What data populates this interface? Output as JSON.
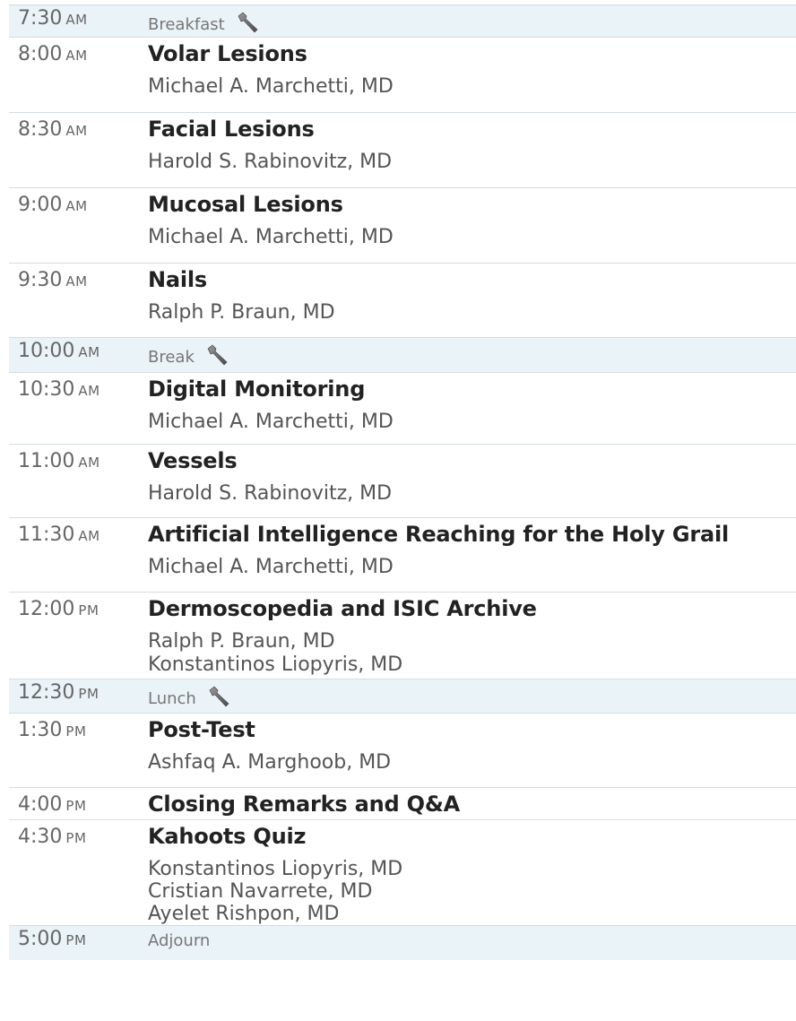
{
  "schedule": [
    {
      "time": "7:30",
      "meridiem": "AM",
      "type": "break",
      "label": "Breakfast",
      "icon": "wrench-icon"
    },
    {
      "time": "8:00",
      "meridiem": "AM",
      "type": "session",
      "title": "Volar Lesions",
      "speakers": [
        "Michael A. Marchetti, MD"
      ]
    },
    {
      "time": "8:30",
      "meridiem": "AM",
      "type": "session",
      "title": "Facial Lesions",
      "speakers": [
        "Harold S. Rabinovitz, MD"
      ]
    },
    {
      "time": "9:00",
      "meridiem": "AM",
      "type": "session",
      "title": "Mucosal Lesions",
      "speakers": [
        "Michael A. Marchetti, MD"
      ]
    },
    {
      "time": "9:30",
      "meridiem": "AM",
      "type": "session",
      "title": "Nails",
      "speakers": [
        "Ralph P. Braun, MD"
      ]
    },
    {
      "time": "10:00",
      "meridiem": "AM",
      "type": "break",
      "label": "Break",
      "icon": "wrench-icon"
    },
    {
      "time": "10:30",
      "meridiem": "AM",
      "type": "session",
      "title": "Digital Monitoring",
      "speakers": [
        "Michael A. Marchetti, MD"
      ]
    },
    {
      "time": "11:00",
      "meridiem": "AM",
      "type": "session",
      "title": "Vessels",
      "speakers": [
        "Harold S. Rabinovitz, MD"
      ]
    },
    {
      "time": "11:30",
      "meridiem": "AM",
      "type": "session",
      "title": "Artificial Intelligence Reaching for the Holy Grail",
      "speakers": [
        "Michael A. Marchetti, MD"
      ]
    },
    {
      "time": "12:00",
      "meridiem": "PM",
      "type": "session",
      "title": "Dermoscopedia and ISIC Archive",
      "speakers": [
        "Ralph P. Braun, MD",
        "Konstantinos Liopyris, MD"
      ]
    },
    {
      "time": "12:30",
      "meridiem": "PM",
      "type": "break",
      "label": "Lunch",
      "icon": "wrench-icon"
    },
    {
      "time": "1:30",
      "meridiem": "PM",
      "type": "session",
      "title": "Post-Test",
      "speakers": [
        "Ashfaq A. Marghoob, MD"
      ]
    },
    {
      "time": "4:00",
      "meridiem": "PM",
      "type": "session",
      "title": "Closing Remarks and Q&A",
      "speakers": []
    },
    {
      "time": "4:30",
      "meridiem": "PM",
      "type": "session",
      "title": "Kahoots Quiz",
      "speakers": [
        "Konstantinos Liopyris, MD",
        "Cristian Navarrete, MD",
        "Ayelet Rishpon, MD"
      ]
    },
    {
      "time": "5:00",
      "meridiem": "PM",
      "type": "break",
      "label": "Adjourn"
    }
  ],
  "colors": {
    "break_background": "#eaf3f8",
    "divider": "#d4dde2",
    "title_text": "#222222",
    "body_text": "#555555"
  }
}
